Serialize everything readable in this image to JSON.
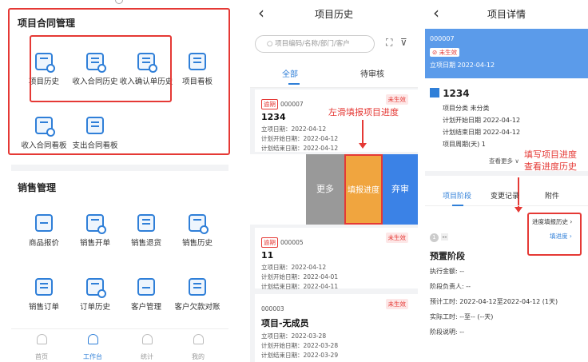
{
  "home": {
    "contract_section": {
      "title": "项目合同管理",
      "items": [
        {
          "label": "项目历史"
        },
        {
          "label": "收入合同历史"
        },
        {
          "label": "收入确认单历史"
        },
        {
          "label": "项目看板"
        },
        {
          "label": "收入合同看板"
        },
        {
          "label": "支出合同看板"
        }
      ]
    },
    "sales_section": {
      "title": "销售管理",
      "items": [
        {
          "label": "商品报价"
        },
        {
          "label": "销售开单"
        },
        {
          "label": "销售退货"
        },
        {
          "label": "销售历史"
        },
        {
          "label": "销售订单"
        },
        {
          "label": "订单历史"
        },
        {
          "label": "客户管理"
        },
        {
          "label": "客户欠款对账"
        }
      ]
    },
    "tabbar": [
      "首页",
      "工作台",
      "统计",
      "我的"
    ]
  },
  "history": {
    "title": "项目历史",
    "search_placeholder": "项目编码/名称/部门/客户",
    "tabs": [
      "全部",
      "待审核"
    ],
    "annotation": "左滑填报项目进度",
    "swipe_actions": [
      "更多",
      "填报进度",
      "弃审"
    ],
    "overdue_label": "逾期",
    "status_label": "未生效",
    "cards": [
      {
        "code": "000007",
        "name": "1234",
        "lines": [
          "立项日期：2022-04-12",
          "计划开始日期：2022-04-12",
          "计划结束日期：2022-04-12"
        ]
      },
      {
        "code": "000005",
        "name": "11",
        "lines": [
          "立项日期：2022-04-12",
          "计划开始日期：2022-04-01",
          "计划结束日期：2022-04-11"
        ]
      },
      {
        "code": "000003",
        "name": "项目-无成员",
        "lines": [
          "立项日期：2022-03-28",
          "计划开始日期：2022-03-28",
          "计划结束日期：2022-03-29"
        ]
      }
    ]
  },
  "detail": {
    "title": "项目详情",
    "banner_code": "000007",
    "banner_status": "未生效",
    "banner_date": "立项日期 2022-04-12",
    "project_name": "1234",
    "fields": [
      "项目分类  未分类",
      "计划开始日期  2022-04-12",
      "计划结束日期  2022-04-12",
      "项目周期(天)  1"
    ],
    "view_more": "查看更多",
    "annotation_line1": "填写项目进度",
    "annotation_line2": "查看进度历史",
    "tabs": [
      "项目阶段",
      "变更记录",
      "附件"
    ],
    "progress_history_link": "进度填报历史",
    "fill_progress_link": "填进度",
    "stage_index": "1",
    "stage_dash": "--",
    "stage_name": "预置阶段",
    "stage_fields": [
      "执行金额: --",
      "阶段负责人: --",
      "预计工时: 2022-04-12至2022-04-12 (1天)",
      "实际工时: --至-- (--天)",
      "阶段说明: --"
    ]
  }
}
